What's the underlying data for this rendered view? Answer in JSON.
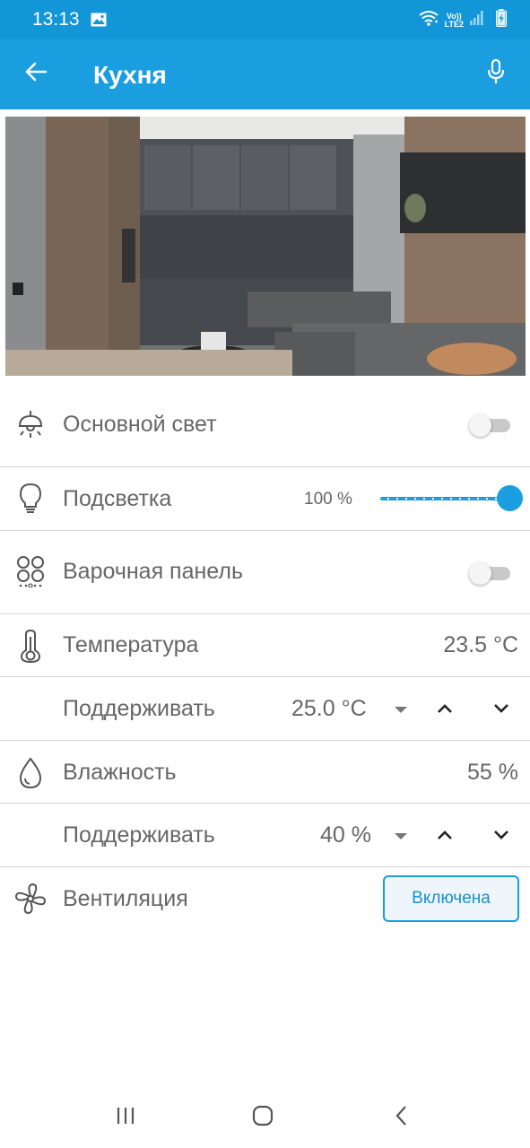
{
  "status_bar": {
    "time": "13:13",
    "lte_line1": "Vo))",
    "lte_line2": "LTE2",
    "icons": [
      "gallery-icon",
      "wifi-icon",
      "signal-icon",
      "battery-charging-icon"
    ]
  },
  "header": {
    "title": "Кухня",
    "back_icon": "arrow-left-icon",
    "mic_icon": "microphone-icon"
  },
  "room_image": {
    "description_icon": "room-photo"
  },
  "devices": {
    "main_light": {
      "label": "Основной свет",
      "on": false,
      "icon": "ceiling-lamp-icon"
    },
    "backlight": {
      "label": "Подсветка",
      "value_text": "100 %",
      "level_percent": 100,
      "icon": "bulb-icon"
    },
    "cooktop": {
      "label": "Варочная панель",
      "on": false,
      "icon": "cooktop-icon"
    },
    "temperature": {
      "label": "Температура",
      "value": "23.5 °C",
      "icon": "thermometer-icon"
    },
    "temperature_setpoint": {
      "label": "Поддерживать",
      "value": "25.0 °C"
    },
    "humidity": {
      "label": "Влажность",
      "value": "55 %",
      "icon": "droplet-icon"
    },
    "humidity_setpoint": {
      "label": "Поддерживать",
      "value": "40 %"
    },
    "ventilation": {
      "label": "Вентиляция",
      "button_label": "Включена",
      "icon": "fan-icon"
    }
  },
  "colors": {
    "accent": "#1a9ee0",
    "status_bar": "#1296d8",
    "divider": "#d4d4d4",
    "text": "#666666"
  },
  "nav_bar": {
    "icons": [
      "recent-apps-icon",
      "home-icon",
      "back-nav-icon"
    ]
  }
}
